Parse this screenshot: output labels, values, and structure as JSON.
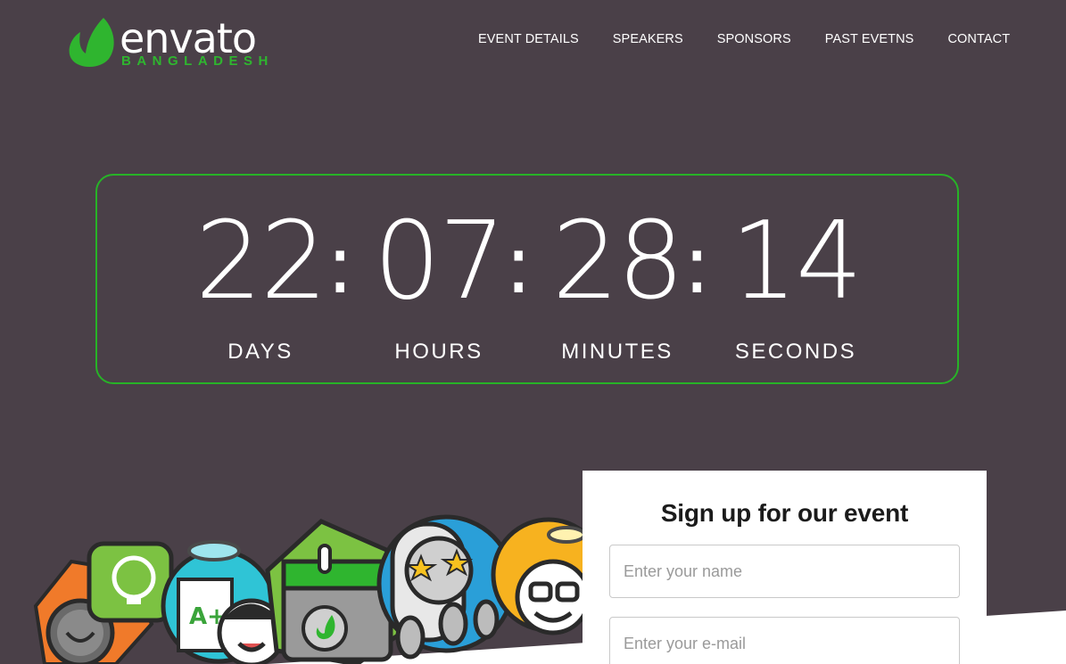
{
  "brand": {
    "name": "envato",
    "subtitle": "BANGLADESH",
    "accent_color": "#2fb52f"
  },
  "nav": {
    "items": [
      "EVENT DETAILS",
      "SPEAKERS",
      "SPONSORS",
      "PAST EVETNS",
      "CONTACT"
    ]
  },
  "countdown": {
    "border_color": "#27b327",
    "units": [
      {
        "value": "22",
        "label": "DAYS"
      },
      {
        "value": "07",
        "label": "HOURS"
      },
      {
        "value": "28",
        "label": "MINUTES"
      },
      {
        "value": "14",
        "label": "SECONDS"
      }
    ],
    "separator": ":"
  },
  "signup": {
    "title": "Sign up for our event",
    "name_placeholder": "Enter your name",
    "email_placeholder": "Enter your e-mail"
  },
  "icons": [
    "envato-leaf-icon",
    "lightbulb-icon",
    "compass-icon",
    "calendar-icon",
    "halo-icon",
    "star-icon",
    "glasses-icon"
  ]
}
